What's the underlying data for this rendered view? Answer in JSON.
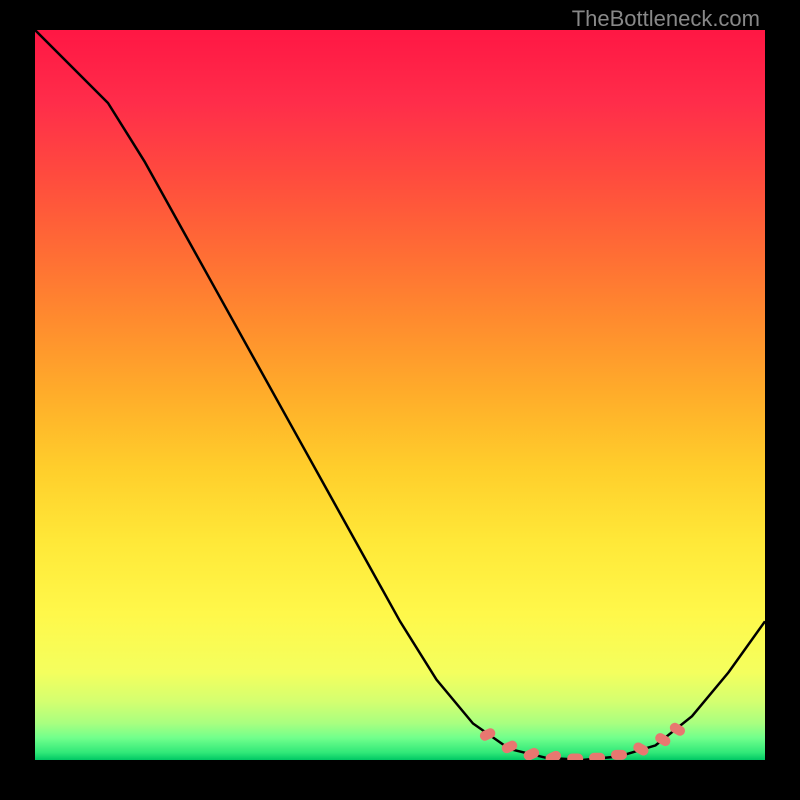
{
  "watermark": "TheBottleneck.com",
  "chart_data": {
    "type": "line",
    "title": "",
    "xlabel": "",
    "ylabel": "",
    "xlim": [
      0,
      100
    ],
    "ylim": [
      0,
      100
    ],
    "curve": [
      {
        "x": 0,
        "y": 100
      },
      {
        "x": 5,
        "y": 95
      },
      {
        "x": 10,
        "y": 90
      },
      {
        "x": 15,
        "y": 82
      },
      {
        "x": 20,
        "y": 73
      },
      {
        "x": 25,
        "y": 64
      },
      {
        "x": 30,
        "y": 55
      },
      {
        "x": 35,
        "y": 46
      },
      {
        "x": 40,
        "y": 37
      },
      {
        "x": 45,
        "y": 28
      },
      {
        "x": 50,
        "y": 19
      },
      {
        "x": 55,
        "y": 11
      },
      {
        "x": 60,
        "y": 5
      },
      {
        "x": 65,
        "y": 1.5
      },
      {
        "x": 70,
        "y": 0.3
      },
      {
        "x": 75,
        "y": 0
      },
      {
        "x": 80,
        "y": 0.5
      },
      {
        "x": 85,
        "y": 2
      },
      {
        "x": 90,
        "y": 6
      },
      {
        "x": 95,
        "y": 12
      },
      {
        "x": 100,
        "y": 19
      }
    ],
    "markers": [
      {
        "x": 62,
        "y": 3.5
      },
      {
        "x": 65,
        "y": 1.8
      },
      {
        "x": 68,
        "y": 0.8
      },
      {
        "x": 71,
        "y": 0.4
      },
      {
        "x": 74,
        "y": 0.2
      },
      {
        "x": 77,
        "y": 0.3
      },
      {
        "x": 80,
        "y": 0.7
      },
      {
        "x": 83,
        "y": 1.5
      },
      {
        "x": 86,
        "y": 2.8
      },
      {
        "x": 88,
        "y": 4.2
      }
    ],
    "gradient_stops": [
      {
        "offset": 0,
        "color": "#ff1744"
      },
      {
        "offset": 10,
        "color": "#ff2d4a"
      },
      {
        "offset": 20,
        "color": "#ff4b3e"
      },
      {
        "offset": 30,
        "color": "#ff6b35"
      },
      {
        "offset": 40,
        "color": "#ff8c2e"
      },
      {
        "offset": 50,
        "color": "#ffad2a"
      },
      {
        "offset": 60,
        "color": "#ffce2b"
      },
      {
        "offset": 70,
        "color": "#ffe838"
      },
      {
        "offset": 80,
        "color": "#fff84a"
      },
      {
        "offset": 88,
        "color": "#f4ff5e"
      },
      {
        "offset": 92,
        "color": "#d4ff70"
      },
      {
        "offset": 95,
        "color": "#a8ff80"
      },
      {
        "offset": 97,
        "color": "#70ff8c"
      },
      {
        "offset": 99,
        "color": "#30e878"
      },
      {
        "offset": 100,
        "color": "#00c864"
      }
    ]
  }
}
